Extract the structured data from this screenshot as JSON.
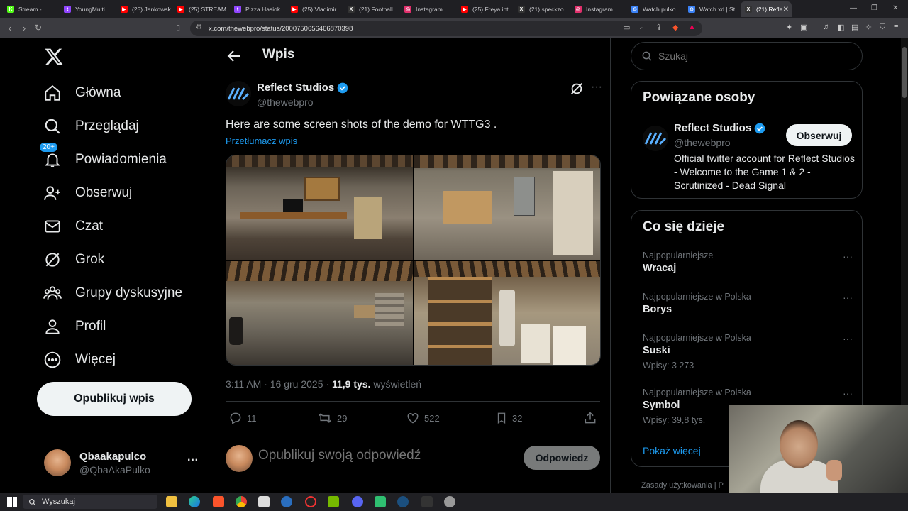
{
  "browser": {
    "tabs": [
      {
        "label": "Stream - ",
        "fav_color": "#53fc18",
        "fav": "K"
      },
      {
        "label": "YoungMulti",
        "fav_color": "#9146ff",
        "fav": "t"
      },
      {
        "label": "(25) Jankowsk",
        "fav_color": "#ff0000",
        "fav": "▶"
      },
      {
        "label": "(25) STREAM",
        "fav_color": "#ff0000",
        "fav": "▶"
      },
      {
        "label": "Pizza Hasiok",
        "fav_color": "#9146ff",
        "fav": "t"
      },
      {
        "label": "(25) Vladimir",
        "fav_color": "#ff0000",
        "fav": "▶"
      },
      {
        "label": "(21) Football",
        "fav_color": "#333333",
        "fav": "X"
      },
      {
        "label": "Instagram",
        "fav_color": "#e1306c",
        "fav": "◎"
      },
      {
        "label": "(25) Freya int",
        "fav_color": "#ff0000",
        "fav": "▶"
      },
      {
        "label": "(21) speckzo",
        "fav_color": "#333333",
        "fav": "X"
      },
      {
        "label": "Instagram",
        "fav_color": "#e1306c",
        "fav": "◎"
      },
      {
        "label": "Watch pulko",
        "fav_color": "#3b82f6",
        "fav": "⊙"
      },
      {
        "label": "Watch xd | St",
        "fav_color": "#3b82f6",
        "fav": "⊙"
      },
      {
        "label": "(21) Refle",
        "fav_color": "#333333",
        "fav": "X",
        "active": true
      }
    ],
    "url": "x.com/thewebpro/status/2000750656466870398"
  },
  "nav": {
    "items": [
      {
        "label": "Główna",
        "icon": "home-icon"
      },
      {
        "label": "Przeglądaj",
        "icon": "search-icon"
      },
      {
        "label": "Powiadomienia",
        "icon": "bell-icon",
        "badge": "20+"
      },
      {
        "label": "Obserwuj",
        "icon": "follow-icon"
      },
      {
        "label": "Czat",
        "icon": "mail-icon"
      },
      {
        "label": "Grok",
        "icon": "grok-icon"
      },
      {
        "label": "Grupy dyskusyjne",
        "icon": "communities-icon"
      },
      {
        "label": "Profil",
        "icon": "profile-icon"
      },
      {
        "label": "Więcej",
        "icon": "more-icon"
      }
    ],
    "publish_label": "Opublikuj wpis",
    "user": {
      "name": "Qbaakapulco",
      "handle": "@QbaAkaPulko",
      "more": "···"
    }
  },
  "post": {
    "header_title": "Wpis",
    "author_name": "Reflect Studios",
    "author_handle": "@thewebpro",
    "text": "Here are some screen shots of the demo for WTTG3 .",
    "translate": "Przetłumacz wpis",
    "time": "3:11 AM · 16 gru 2025 · ",
    "views": "11,9 tys.",
    "views_label": " wyświetleń",
    "stats": {
      "replies": "11",
      "reposts": "29",
      "likes": "522",
      "bookmarks": "32"
    },
    "reply_placeholder": "Opublikuj swoją odpowiedź",
    "reply_button": "Odpowiedz"
  },
  "sidebar": {
    "search_placeholder": "Szukaj",
    "related": {
      "title": "Powiązane osoby",
      "name": "Reflect Studios",
      "handle": "@thewebpro",
      "bio": "Official twitter account for Reflect Studios - Welcome to the Game 1 & 2 - Scrutinized - Dead Signal",
      "follow_label": "Obserwuj"
    },
    "trends": {
      "title": "Co się dzieje",
      "items": [
        {
          "category": "Najpopularniejsze",
          "name": "Wracaj",
          "count": ""
        },
        {
          "category": "Najpopularniejsze w Polska",
          "name": "Borys",
          "count": ""
        },
        {
          "category": "Najpopularniejsze w Polska",
          "name": "Suski",
          "count": "Wpisy: 3 273"
        },
        {
          "category": "Najpopularniejsze w Polska",
          "name": "Symbol",
          "count": "Wpisy: 39,8 tys."
        }
      ],
      "show_more": "Pokaż więcej"
    },
    "footer": "Zasady użytkowania  |  P"
  },
  "taskbar": {
    "search_label": "Wyszukaj"
  }
}
